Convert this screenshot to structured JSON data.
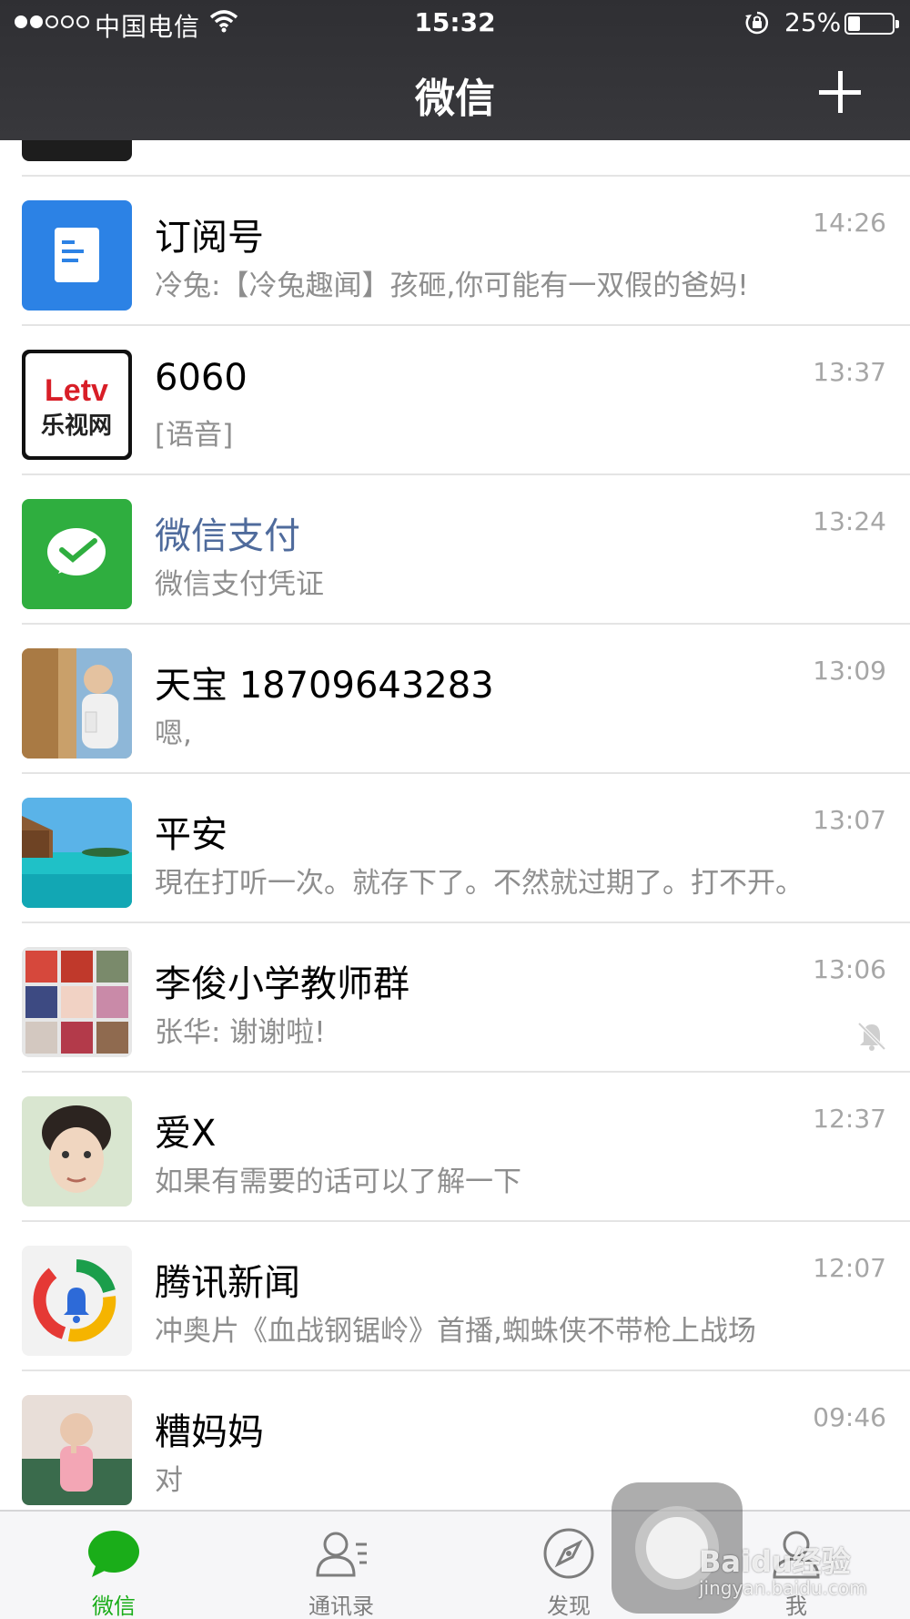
{
  "status_bar": {
    "carrier": "中国电信",
    "time": "15:32",
    "battery": "25%",
    "battery_level": 0.25
  },
  "nav": {
    "title": "微信",
    "add_icon": "plus-icon"
  },
  "chats": [
    {
      "name": "订阅号",
      "preview": "冷兔:【冷兔趣闻】孩砸,你可能有一双假的爸妈!",
      "time": "14:26",
      "avatar": "subscription-icon"
    },
    {
      "name": "6060",
      "preview": "[语音]",
      "time": "13:37",
      "avatar": "letv-logo"
    },
    {
      "name": "微信支付",
      "preview": "微信支付凭证",
      "time": "13:24",
      "avatar": "wechat-pay-icon"
    },
    {
      "name": "天宝 18709643283",
      "preview": "嗯,",
      "time": "13:09",
      "avatar": "photo-avatar"
    },
    {
      "name": "平安",
      "preview": "現在打听一次。就存下了。不然就过期了。打不开。",
      "time": "13:07",
      "avatar": "beach-avatar"
    },
    {
      "name": "李俊小学教师群",
      "preview": "张华: 谢谢啦!",
      "time": "13:06",
      "avatar": "group-avatar",
      "muted": true
    },
    {
      "name": "爱X",
      "preview": "如果有需要的话可以了解一下",
      "time": "12:37",
      "avatar": "photo-avatar"
    },
    {
      "name": "腾讯新闻",
      "preview": "冲奥片《血战钢锯岭》首播,蜘蛛侠不带枪上战场",
      "time": "12:07",
      "avatar": "tencent-news-logo"
    },
    {
      "name": "糟妈妈",
      "preview": "对",
      "time": "09:46",
      "avatar": "photo-avatar"
    }
  ],
  "tabs": [
    {
      "label": "微信",
      "icon": "chat-bubble-icon",
      "active": true
    },
    {
      "label": "通讯录",
      "icon": "contacts-icon",
      "active": false
    },
    {
      "label": "发现",
      "icon": "compass-icon",
      "active": false
    },
    {
      "label": "我",
      "icon": "person-icon",
      "active": false
    }
  ],
  "watermark": {
    "text": "Baidu经验",
    "sub": "jingyan.baidu.com"
  },
  "colors": {
    "accent": "#1aad19",
    "nav_bg": "#333336",
    "brand_name": "#4f6b9c"
  }
}
